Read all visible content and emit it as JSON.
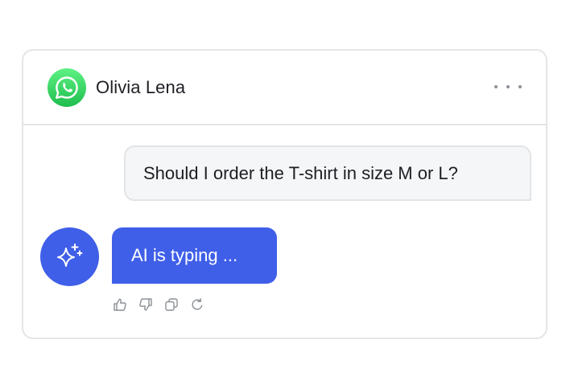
{
  "header": {
    "app_icon": "whatsapp-icon",
    "contact_name": "Olivia Lena",
    "menu_icon": "more-horizontal-icon"
  },
  "messages": [
    {
      "sender": "user",
      "text": "Should I order the T-shirt in size M or L?"
    },
    {
      "sender": "ai",
      "text": "AI is typing ...",
      "avatar_icon": "sparkles-icon"
    }
  ],
  "actions": [
    "thumbs-up-icon",
    "thumbs-down-icon",
    "copy-icon",
    "refresh-icon"
  ],
  "colors": {
    "accent": "#3f5fe8",
    "whatsapp_green": "#25d366",
    "border": "#e4e5e7",
    "user_bubble_bg": "#f5f6f7",
    "text": "#1d1f24",
    "icon_gray": "#8c9096"
  }
}
